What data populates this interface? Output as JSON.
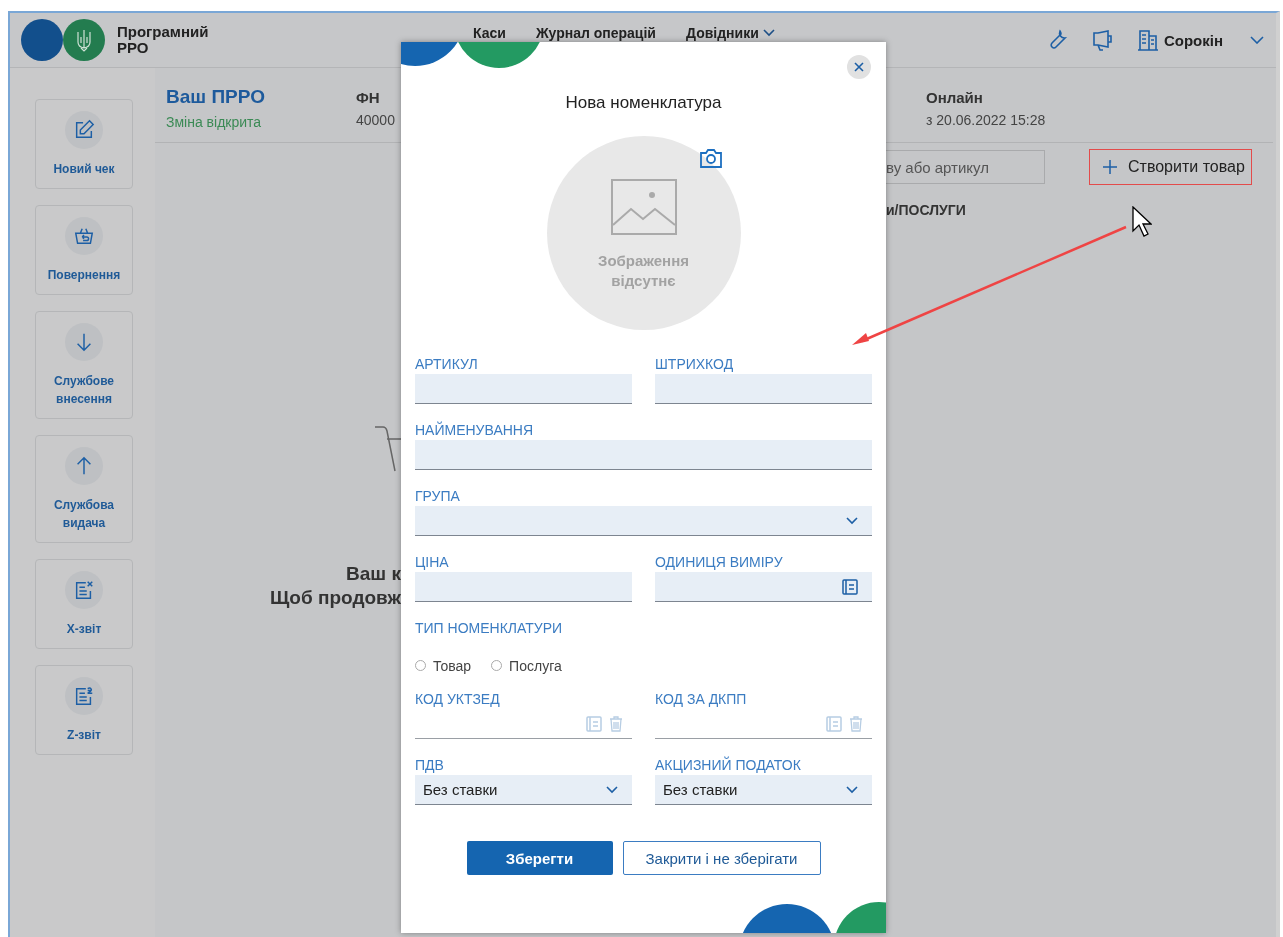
{
  "header": {
    "logo_text": "Програмний РРО",
    "nav": [
      {
        "label": "Каси",
        "has_menu": false
      },
      {
        "label": "Журнал операцій",
        "has_menu": false
      },
      {
        "label": "Довідники",
        "has_menu": true
      }
    ],
    "user": "Сорокін"
  },
  "sidebar": {
    "items": [
      {
        "kind": "new-check",
        "label": "Новий чек"
      },
      {
        "kind": "return",
        "label": "Повернення"
      },
      {
        "kind": "deposit",
        "label": "Службове внесення"
      },
      {
        "kind": "withdrawal",
        "label": "Службова видача"
      },
      {
        "kind": "x-report",
        "label": "X-звіт"
      },
      {
        "kind": "z-report",
        "label": "Z-звіт"
      }
    ]
  },
  "register": {
    "title": "Ваш ПРРО",
    "status": "Зміна відкрита",
    "fn_label": "ФН",
    "fn_value": "40000",
    "online_label": "Онлайн",
    "online_value": "з 20.06.2022 15:28"
  },
  "search": {
    "placeholder": "ву або артикул"
  },
  "create_button": {
    "label": "Створити товар"
  },
  "section_heading": "и/ПОСЛУГИ",
  "empty_state": {
    "lines": [
      "Ваш к",
      "Щоб продовж"
    ]
  },
  "modal": {
    "title": "Нова номенклатура",
    "image_placeholder": "Зображення відсутнє",
    "fields": [
      {
        "label": "АРТИКУЛ",
        "kind": "text",
        "wide": false
      },
      {
        "label": "ШТРИХКОД",
        "kind": "text",
        "wide": false
      },
      {
        "label": "НАЙМЕНУВАННЯ",
        "kind": "text",
        "wide": true
      },
      {
        "label": "ГРУПА",
        "kind": "select",
        "wide": true
      },
      {
        "label": "ЦІНА",
        "kind": "text",
        "wide": false
      },
      {
        "label": "ОДИНИЦЯ ВИМІРУ",
        "kind": "lookup",
        "wide": false
      },
      {
        "label": "ТИП НОМЕНКЛАТУРИ",
        "kind": "radio",
        "wide": true,
        "options": [
          {
            "label": "Товар",
            "selected": false
          },
          {
            "label": "Послуга",
            "selected": false
          }
        ]
      },
      {
        "label": "КОД УКТЗЕД",
        "kind": "code",
        "wide": false
      },
      {
        "label": "КОД ЗА ДКПП",
        "kind": "code",
        "wide": false
      },
      {
        "label": "ПДВ",
        "kind": "select",
        "wide": false,
        "value": "Без ставки"
      },
      {
        "label": "АКЦИЗНИЙ ПОДАТОК",
        "kind": "select",
        "wide": false,
        "value": "Без ставки"
      }
    ],
    "buttons": [
      {
        "label": "Зберегти",
        "kind": "primary"
      },
      {
        "label": "Закрити і не зберігати",
        "kind": "secondary"
      }
    ]
  }
}
